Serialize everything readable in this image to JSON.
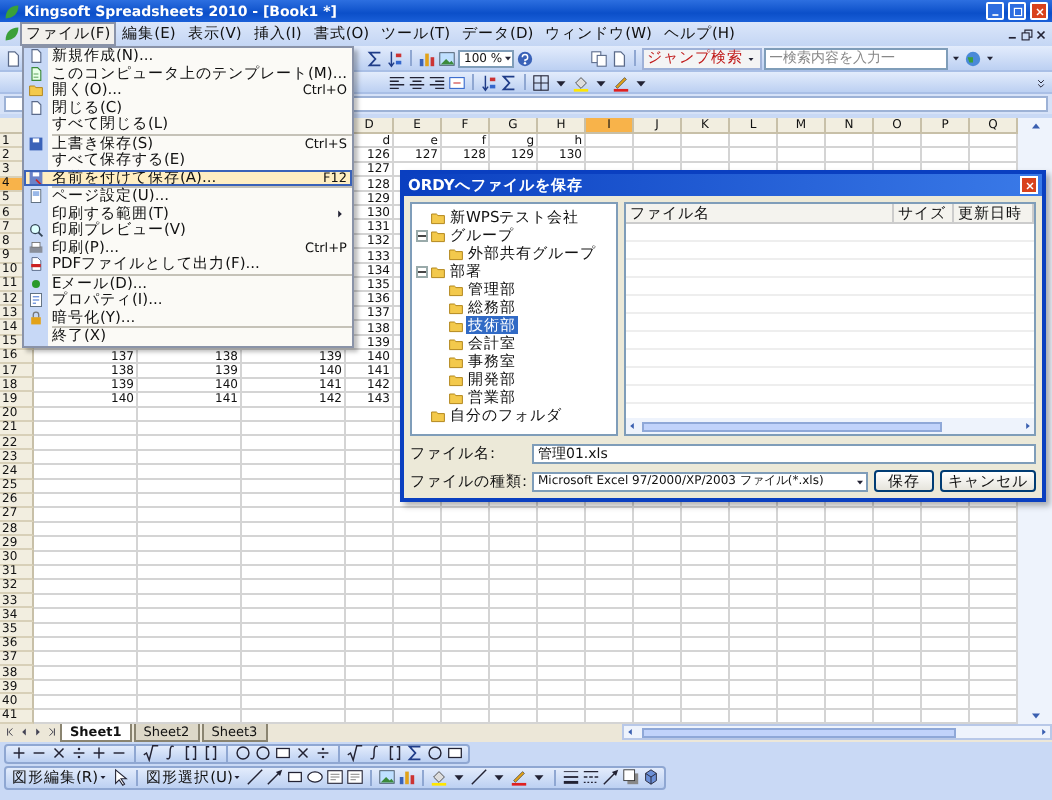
{
  "window": {
    "title": "Kingsoft Spreadsheets 2010 - [Book1 *]"
  },
  "menu_bar": [
    {
      "label": "ファイル(F)",
      "selected": true
    },
    {
      "label": "編集(E)",
      "selected": false
    },
    {
      "label": "表示(V)",
      "selected": false
    },
    {
      "label": "挿入(I)",
      "selected": false
    },
    {
      "label": "書式(O)",
      "selected": false
    },
    {
      "label": "ツール(T)",
      "selected": false
    },
    {
      "label": "データ(D)",
      "selected": false
    },
    {
      "label": "ウィンドウ(W)",
      "selected": false
    },
    {
      "label": "ヘルプ(H)",
      "selected": false
    }
  ],
  "toolbar": {
    "zoom": "100 %",
    "search_button": "ジャンプ検索",
    "search": {
      "placeholder": "一検索内容を入力一"
    }
  },
  "file_menu": [
    {
      "label": "新規作成(N)...",
      "selected": false,
      "divider_after": false
    },
    {
      "label": "このコンピュータ上のテンプレート(M)...",
      "selected": false,
      "divider_after": false
    },
    {
      "label": "開く(O)...",
      "shortcut": "Ctrl+O",
      "selected": false,
      "divider_after": false
    },
    {
      "label": "閉じる(C)",
      "selected": false,
      "divider_after": false
    },
    {
      "label": "すべて閉じる(L)",
      "selected": false,
      "divider_after": true
    },
    {
      "label": "上書き保存(S)",
      "shortcut": "Ctrl+S",
      "selected": false,
      "divider_after": false
    },
    {
      "label": "すべて保存する(E)",
      "selected": false,
      "divider_after": false
    },
    {
      "label": "名前を付けて保存(A)...",
      "shortcut": "F12",
      "selected": true,
      "divider_after": true
    },
    {
      "label": "ページ設定(U)...",
      "selected": false,
      "divider_after": false
    },
    {
      "label": "印刷する範囲(T)",
      "submenu": true,
      "selected": false,
      "divider_after": false
    },
    {
      "label": "印刷プレビュー(V)",
      "selected": false,
      "divider_after": false
    },
    {
      "label": "印刷(P)...",
      "shortcut": "Ctrl+P",
      "selected": false,
      "divider_after": false
    },
    {
      "label": "PDFファイルとして出力(F)...",
      "selected": false,
      "divider_after": true
    },
    {
      "label": "Eメール(D)...",
      "selected": false,
      "divider_after": false
    },
    {
      "label": "プロパティ(I)...",
      "selected": false,
      "divider_after": false
    },
    {
      "label": "暗号化(Y)...",
      "selected": false,
      "divider_after": true
    },
    {
      "label": "終了(X)",
      "selected": false,
      "divider_after": false
    }
  ],
  "sheet": {
    "columns": [
      {
        "label": "D",
        "selected": false
      },
      {
        "label": "E",
        "selected": false
      },
      {
        "label": "F",
        "selected": false
      },
      {
        "label": "G",
        "selected": false
      },
      {
        "label": "H",
        "selected": false
      },
      {
        "label": "I",
        "selected": true
      },
      {
        "label": "J",
        "selected": false
      },
      {
        "label": "K",
        "selected": false
      },
      {
        "label": "L",
        "selected": false
      },
      {
        "label": "M",
        "selected": false
      },
      {
        "label": "N",
        "selected": false
      },
      {
        "label": "O",
        "selected": false
      },
      {
        "label": "P",
        "selected": false
      },
      {
        "label": "Q",
        "selected": false
      }
    ],
    "rows": [
      {
        "number": "1",
        "selected": false,
        "cells": {
          "D": "d",
          "E": "e",
          "F": "f",
          "G": "g",
          "H": "h"
        }
      },
      {
        "number": "2",
        "selected": false,
        "cells": {
          "D": "126",
          "E": "127",
          "F": "128",
          "G": "129",
          "H": "130"
        }
      },
      {
        "number": "3",
        "selected": false,
        "cells": {
          "D": "127"
        }
      },
      {
        "number": "4",
        "selected": true,
        "cells": {
          "D": "128"
        }
      },
      {
        "number": "5",
        "selected": false,
        "cells": {
          "D": "129"
        }
      },
      {
        "number": "6",
        "selected": false,
        "cells": {
          "D": "130"
        }
      },
      {
        "number": "7",
        "selected": false,
        "cells": {
          "D": "131"
        }
      },
      {
        "number": "8",
        "selected": false,
        "cells": {
          "D": "132"
        }
      },
      {
        "number": "9",
        "selected": false,
        "cells": {
          "D": "133"
        }
      },
      {
        "number": "10",
        "selected": false,
        "cells": {
          "D": "134"
        }
      },
      {
        "number": "11",
        "selected": false,
        "cells": {
          "D": "135"
        }
      },
      {
        "number": "12",
        "selected": false,
        "cells": {
          "D": "136"
        }
      },
      {
        "number": "13",
        "selected": false,
        "cells": {
          "D": "137"
        }
      },
      {
        "number": "14",
        "selected": false,
        "cells": {
          "D": "138"
        }
      },
      {
        "number": "15",
        "selected": false,
        "cells": {
          "D": "139"
        }
      },
      {
        "number": "16",
        "selected": false,
        "cells": {
          "A": "137",
          "B": "138",
          "C": "139",
          "D": "140"
        }
      },
      {
        "number": "17",
        "selected": false,
        "cells": {
          "A": "138",
          "B": "139",
          "C": "140",
          "D": "141"
        }
      },
      {
        "number": "18",
        "selected": false,
        "cells": {
          "A": "139",
          "B": "140",
          "C": "141",
          "D": "142"
        }
      },
      {
        "number": "19",
        "selected": false,
        "cells": {
          "A": "140",
          "B": "141",
          "C": "142",
          "D": "143"
        }
      },
      {
        "number": "20",
        "selected": false
      },
      {
        "number": "21",
        "selected": false
      },
      {
        "number": "22",
        "selected": false
      },
      {
        "number": "23",
        "selected": false
      },
      {
        "number": "24",
        "selected": false
      },
      {
        "number": "25",
        "selected": false
      },
      {
        "number": "26",
        "selected": false
      },
      {
        "number": "27",
        "selected": false
      },
      {
        "number": "28",
        "selected": false
      },
      {
        "number": "29",
        "selected": false
      },
      {
        "number": "30",
        "selected": false
      },
      {
        "number": "31",
        "selected": false
      },
      {
        "number": "32",
        "selected": false
      },
      {
        "number": "33",
        "selected": false
      },
      {
        "number": "34",
        "selected": false
      },
      {
        "number": "35",
        "selected": false
      },
      {
        "number": "36",
        "selected": false
      },
      {
        "number": "37",
        "selected": false
      },
      {
        "number": "38",
        "selected": false
      },
      {
        "number": "39",
        "selected": false
      },
      {
        "number": "40",
        "selected": false
      },
      {
        "number": "41",
        "selected": false
      }
    ]
  },
  "sheet_tabs": [
    {
      "label": "Sheet1",
      "selected": true
    },
    {
      "label": "Sheet2",
      "selected": false
    },
    {
      "label": "Sheet3",
      "selected": false
    }
  ],
  "drawing_toolbar": {
    "draw_menu": "図形編集(R)",
    "select_menu": "図形選択(U)"
  },
  "dialog": {
    "title": "ORDYへファイルを保存",
    "tree": [
      {
        "label": "新WPSテスト会社",
        "selected": false
      },
      {
        "label": "グループ",
        "selected": false,
        "expanded": true,
        "children": [
          {
            "label": "外部共有グループ",
            "selected": false
          }
        ]
      },
      {
        "label": "部署",
        "selected": false,
        "expanded": true,
        "children": [
          {
            "label": "管理部",
            "selected": false
          },
          {
            "label": "総務部",
            "selected": false
          },
          {
            "label": "技術部",
            "selected": true
          },
          {
            "label": "会計室",
            "selected": false
          },
          {
            "label": "事務室",
            "selected": false
          },
          {
            "label": "開発部",
            "selected": false
          },
          {
            "label": "営業部",
            "selected": false
          }
        ]
      },
      {
        "label": "自分のフォルダ",
        "selected": false
      }
    ],
    "list_columns": [
      "ファイル名",
      "サイズ",
      "更新日時"
    ],
    "file_name_label": "ファイル名:",
    "file_name": "管理01.xls",
    "file_type_label": "ファイルの種類:",
    "file_type": "Microsoft Excel 97/2000/XP/2003 ファイル(*.xls)",
    "buttons": [
      "保存",
      "キャンセル"
    ]
  }
}
